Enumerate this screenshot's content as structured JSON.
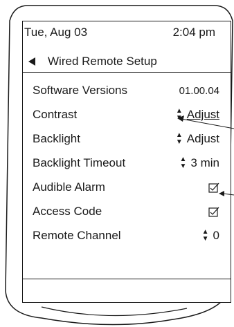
{
  "header": {
    "date": "Tue, Aug 03",
    "time": "2:04 pm",
    "title": "Wired Remote Setup"
  },
  "menu": [
    {
      "label": "Software Versions",
      "value": "01.00.04"
    },
    {
      "label": "Contrast",
      "value": "Adjust"
    },
    {
      "label": "Backlight",
      "value": "Adjust"
    },
    {
      "label": "Backlight Timeout",
      "value": "3 min"
    },
    {
      "label": "Audible Alarm",
      "value": ""
    },
    {
      "label": "Access Code",
      "value": ""
    },
    {
      "label": "Remote Channel",
      "value": "0"
    }
  ],
  "icons": {
    "back": "left-triangle-icon",
    "updown": "up-down-arrows-icon",
    "checkbox": "checked-box-icon"
  },
  "checked": {
    "audible_alarm": true,
    "access_code": true
  }
}
